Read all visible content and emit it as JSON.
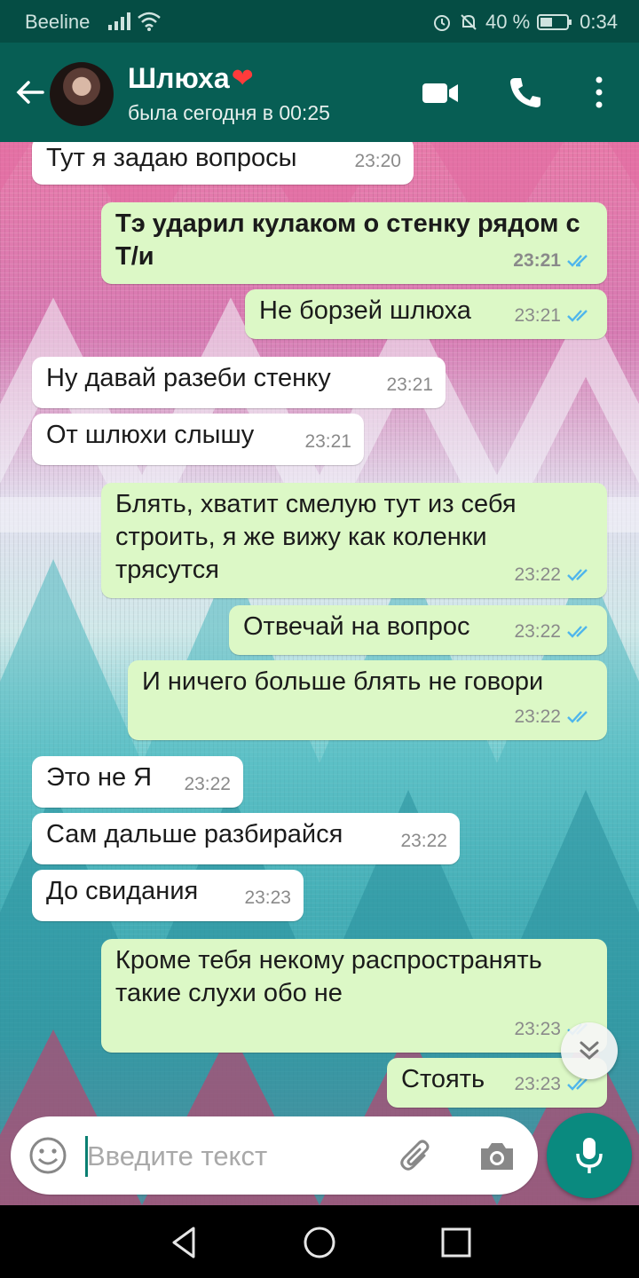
{
  "status_bar": {
    "carrier": "Beeline",
    "battery": "40 %",
    "time": "0:34"
  },
  "header": {
    "contact_name": "Шлюха",
    "status": "была сегодня в 00:25"
  },
  "messages": [
    {
      "direction": "in",
      "text": "Тут я задаю вопросы",
      "time": "23:20",
      "bold": false
    },
    {
      "direction": "out",
      "text": "Тэ ударил кулаком о стенку рядом с Т/и",
      "time": "23:21",
      "bold": true
    },
    {
      "direction": "out",
      "text": "Не борзей шлюха",
      "time": "23:21",
      "bold": false
    },
    {
      "direction": "in",
      "text": "Ну давай разеби стенку",
      "time": "23:21",
      "bold": false
    },
    {
      "direction": "in",
      "text": "От шлюхи слышу",
      "time": "23:21",
      "bold": false
    },
    {
      "direction": "out",
      "text": "Блять, хватит смелую тут из себя строить, я же вижу как коленки трясутся",
      "time": "23:22",
      "bold": false
    },
    {
      "direction": "out",
      "text": "Отвечай на вопрос",
      "time": "23:22",
      "bold": false
    },
    {
      "direction": "out",
      "text": "И ничего больше блять не говори",
      "time": "23:22",
      "bold": false
    },
    {
      "direction": "in",
      "text": "Это не Я",
      "time": "23:22",
      "bold": false
    },
    {
      "direction": "in",
      "text": "Сам дальше разбирайся",
      "time": "23:22",
      "bold": false
    },
    {
      "direction": "in",
      "text": "До свидания",
      "time": "23:23",
      "bold": false
    },
    {
      "direction": "out",
      "text": "Кроме тебя некому распространять такие слухи обо не",
      "time": "23:23",
      "bold": false
    },
    {
      "direction": "out",
      "text": "Стоять",
      "time": "23:23",
      "bold": false
    }
  ],
  "input": {
    "placeholder": "Введите текст",
    "value": ""
  },
  "colors": {
    "header": "#075e54",
    "status_bar": "#054d44",
    "outgoing_bubble": "#dcf8c6",
    "incoming_bubble": "#ffffff",
    "read_ticks": "#4fb6ec",
    "mic_button": "#0a8a7f"
  },
  "icons": {
    "header": [
      "back-arrow-icon",
      "video-call-icon",
      "phone-icon",
      "more-vert-icon"
    ],
    "input": [
      "emoji-icon",
      "attach-icon",
      "camera-icon",
      "mic-icon"
    ],
    "nav": [
      "nav-back-icon",
      "nav-home-icon",
      "nav-recents-icon"
    ]
  }
}
